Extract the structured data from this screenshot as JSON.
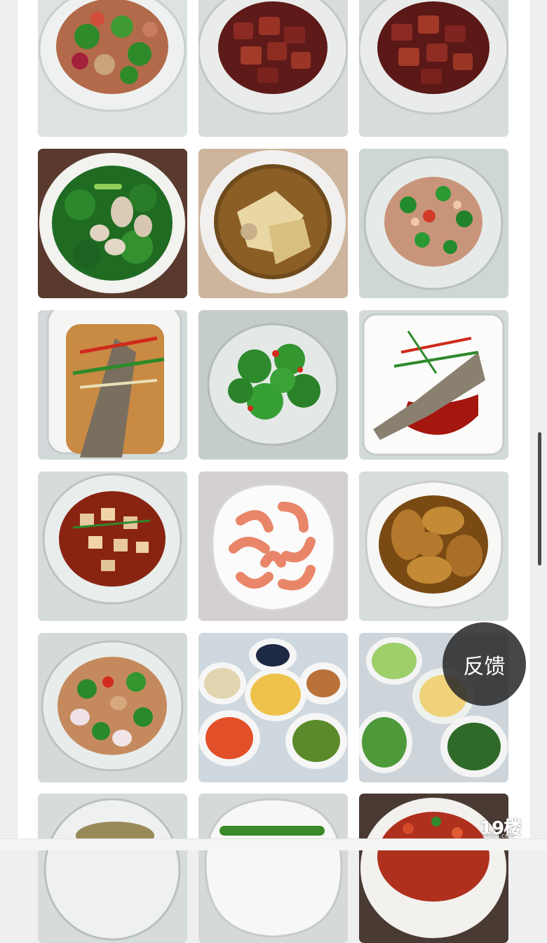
{
  "feedback": {
    "label": "反馈"
  },
  "watermark": {
    "main": "19楼",
    "sub": "19lou.com"
  },
  "gallery": {
    "rows": 6,
    "columns": 3,
    "photos": [
      "stir-fried-peppers-onion-plate",
      "braised-pork-belly-plate",
      "braised-pork-belly-plate-2",
      "stir-fried-greens-mushroom-plate",
      "chicken-soup-bowl",
      "shrimp-green-pepper-plate",
      "steamed-fish-chili-plate",
      "stir-fried-broccoli-plate",
      "steamed-fish-sauce-plate",
      "mapo-tofu-plate",
      "boiled-shrimp-plate",
      "braised-chicken-wings-plate",
      "stir-fried-chicken-pepper-plate",
      "family-meal-set-dishes",
      "vegetable-side-dishes-set",
      "fish-dish-partial",
      "green-vegetable-dish-partial",
      "chili-fish-dish-partial"
    ]
  }
}
